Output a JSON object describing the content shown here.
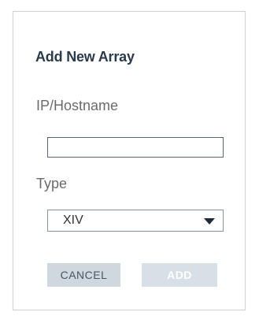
{
  "dialog": {
    "title": "Add New Array",
    "ip_label": "IP/Hostname",
    "ip_value": "",
    "type_label": "Type",
    "type_selected": "XIV",
    "cancel_label": "CANCEL",
    "add_label": "ADD",
    "icons": {
      "dropdown": "caret-down-icon"
    }
  }
}
